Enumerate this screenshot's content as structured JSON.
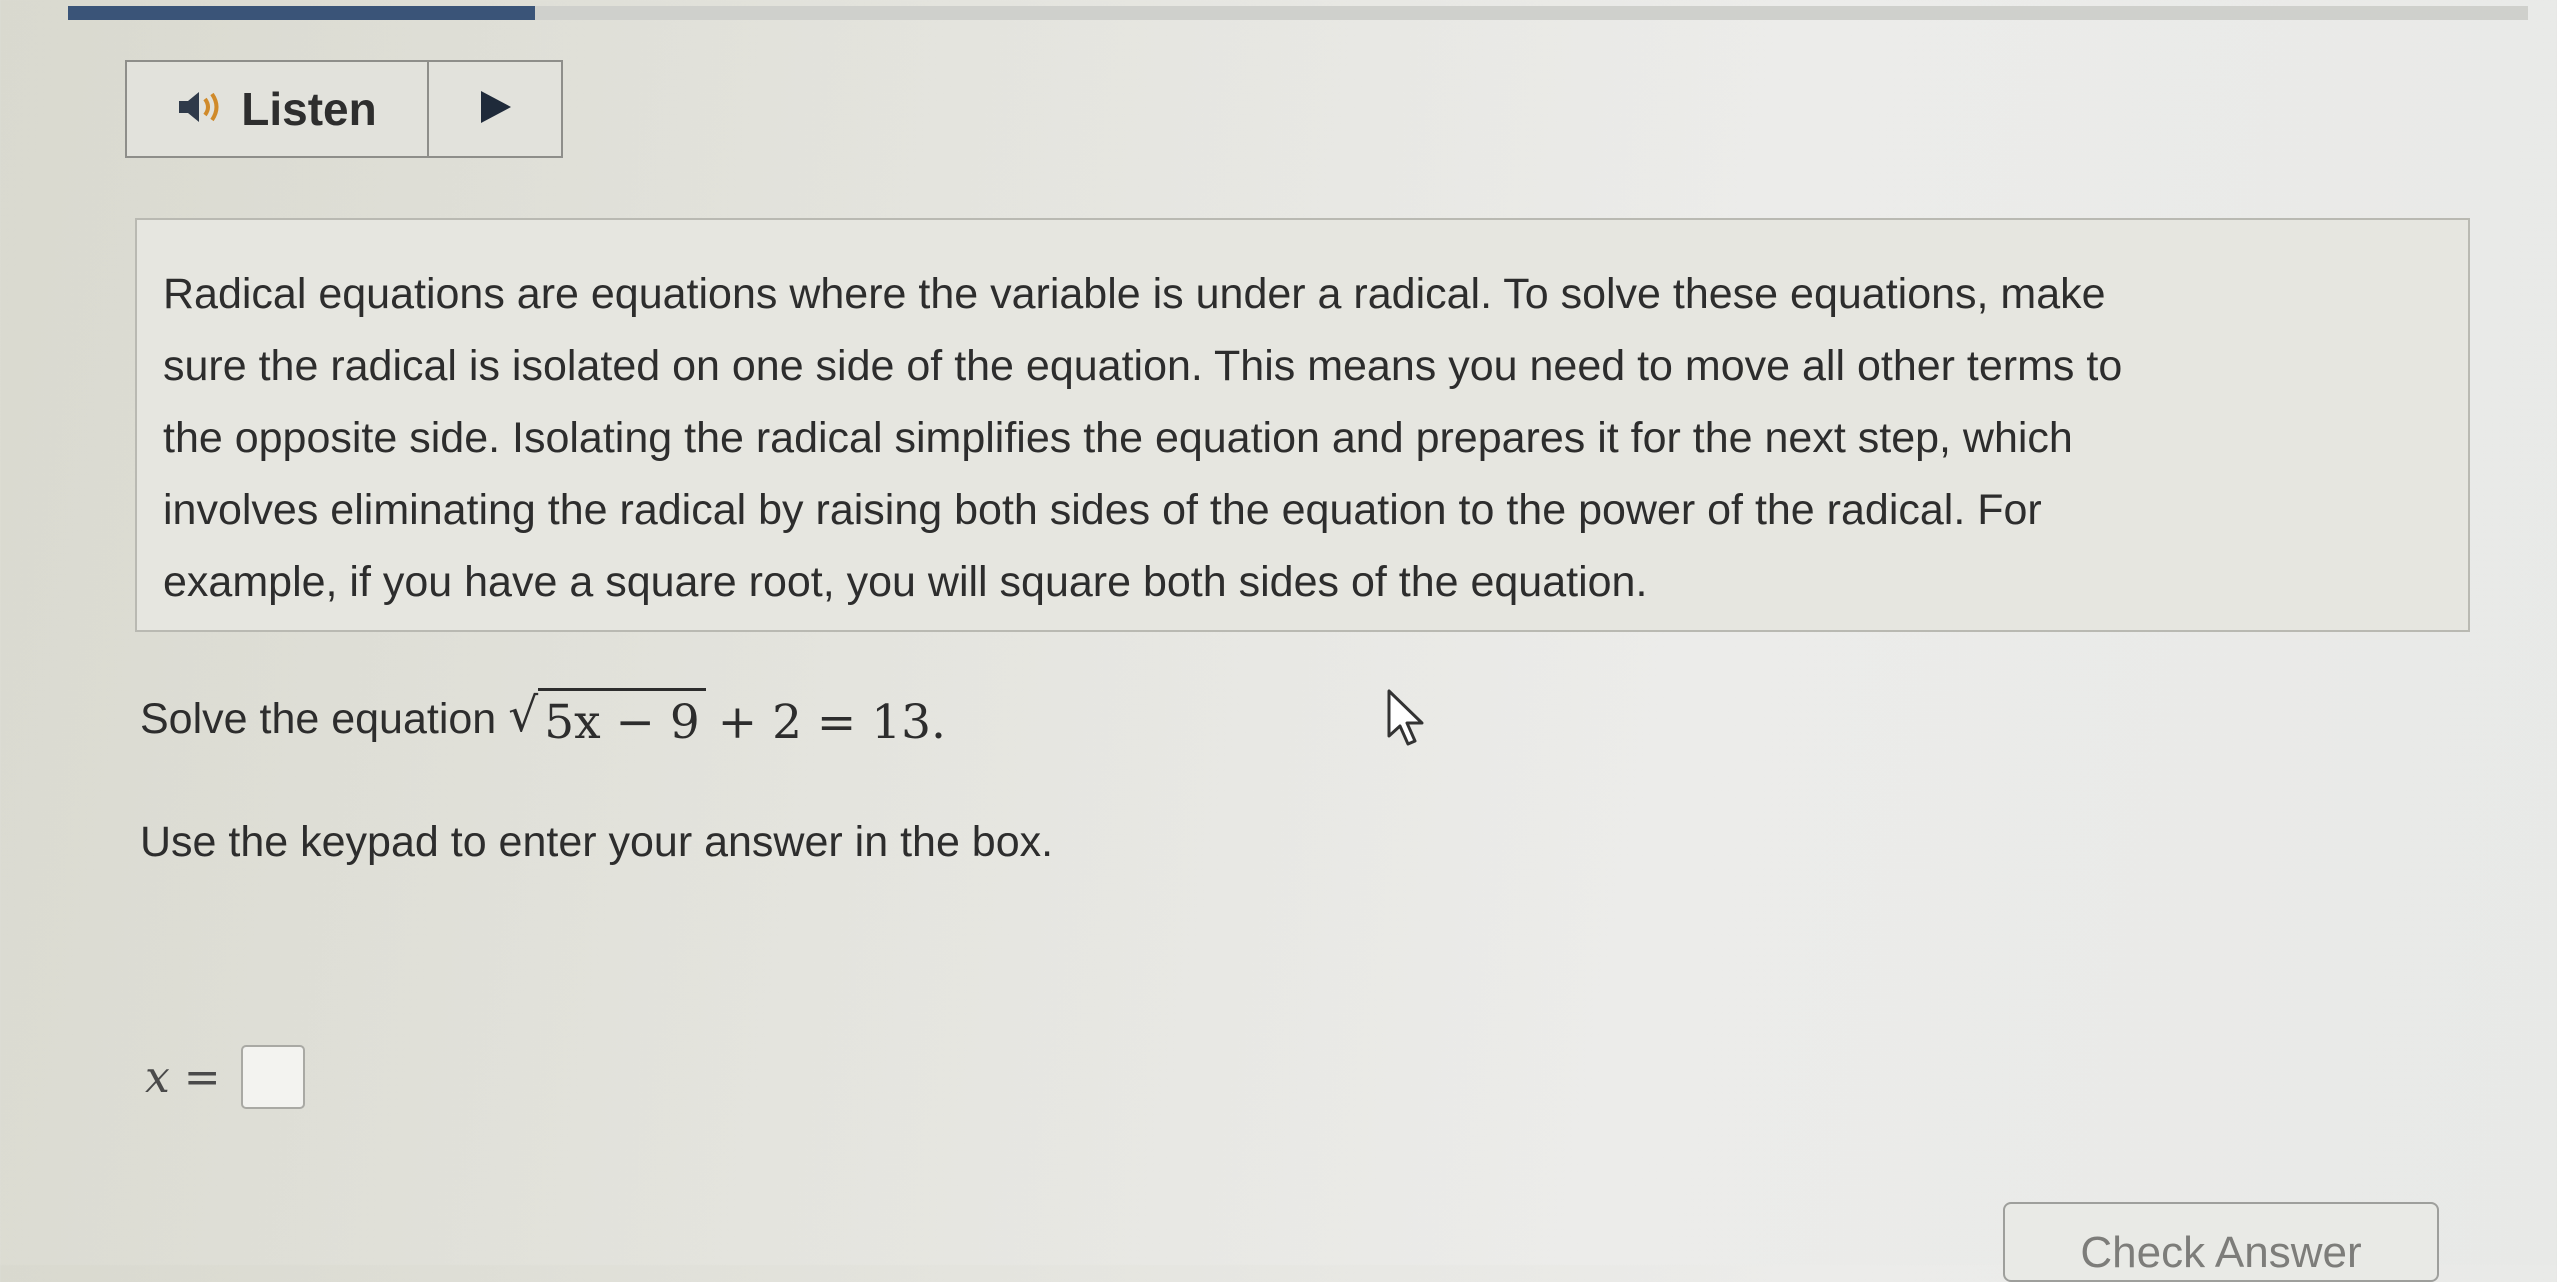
{
  "progress": {
    "fraction": 0.19
  },
  "listen": {
    "label": "Listen",
    "speaker_icon": "speaker-icon",
    "play_icon": "play-icon"
  },
  "info": {
    "lines": [
      "Radical equations are equations where the variable is under a radical. To solve these equations, make",
      "sure the radical is isolated on one side of the equation. This means you need to move all other terms to",
      "the opposite side. Isolating the radical simplifies the equation and prepares it for the next step, which",
      "involves eliminating the radical by raising both sides of the equation to the power of the radical. For",
      "example, if you have a square root, you will square both sides of the equation."
    ]
  },
  "question": {
    "prefix": "Solve the equation",
    "radicand": "5x − 9",
    "tail": "+ 2 = 13."
  },
  "instruction": "Use the keypad to enter your answer in the box.",
  "answer": {
    "label": "x =",
    "value": ""
  },
  "check_button": {
    "label": "Check Answer"
  },
  "colors": {
    "progress_fill": "#3a5478",
    "background": "#e4e4de"
  }
}
